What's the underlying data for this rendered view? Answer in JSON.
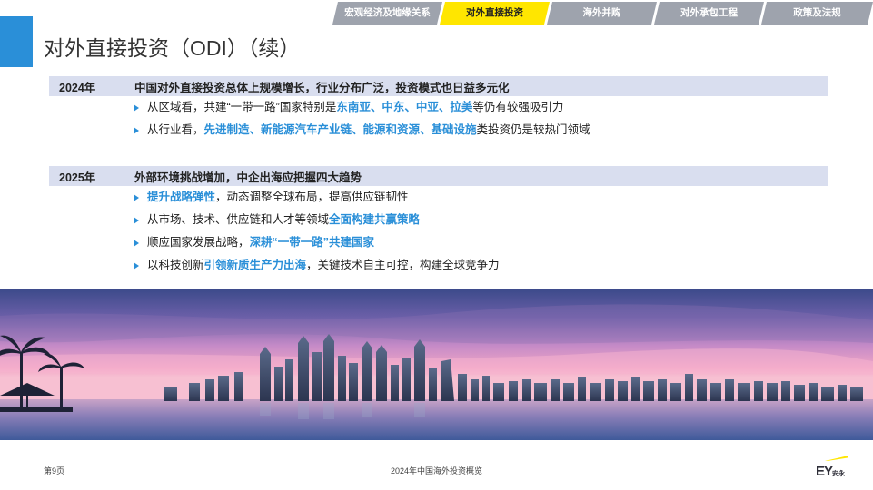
{
  "title": "对外直接投资（ODI）（续）",
  "nav_tabs": [
    {
      "label": "宏观经济及地缘关系",
      "active": false
    },
    {
      "label": "对外直接投资",
      "active": true
    },
    {
      "label": "海外并购",
      "active": false
    },
    {
      "label": "对外承包工程",
      "active": false
    },
    {
      "label": "政策及法规",
      "active": false
    }
  ],
  "sections": [
    {
      "year": "2024年",
      "headline": "中国对外直接投资总体上规模增长，行业分布广泛，投资模式也日益多元化",
      "bullets": [
        {
          "segments": [
            {
              "text": "从区域看，共建“一带一路”国家特别是",
              "hl": false
            },
            {
              "text": "东南亚、中东、中亚、拉美",
              "hl": true
            },
            {
              "text": "等仍有较强吸引力",
              "hl": false
            }
          ]
        },
        {
          "segments": [
            {
              "text": "从行业看，",
              "hl": false
            },
            {
              "text": "先进制造、新能源汽车产业链、能源和资源、基础设施",
              "hl": true
            },
            {
              "text": "类投资仍是较热门领域",
              "hl": false
            }
          ]
        }
      ]
    },
    {
      "year": "2025年",
      "headline": "外部环境挑战增加，中企出海应把握四大趋势",
      "bullets": [
        {
          "segments": [
            {
              "text": "提升战略弹性",
              "hl": true
            },
            {
              "text": "，动态调整全球布局，提高供应链韧性",
              "hl": false
            }
          ]
        },
        {
          "segments": [
            {
              "text": "从市场、技术、供应链和人才等领域",
              "hl": false
            },
            {
              "text": "全面构建共赢策略",
              "hl": true
            }
          ]
        },
        {
          "segments": [
            {
              "text": "顺应国家发展战略，",
              "hl": false
            },
            {
              "text": "深耕“一带一路”共建国家",
              "hl": true
            }
          ]
        },
        {
          "segments": [
            {
              "text": "以科技创新",
              "hl": false
            },
            {
              "text": "引领新质生产力出海",
              "hl": true
            },
            {
              "text": "，关键技术自主可控，构建全球竞争力",
              "hl": false
            }
          ]
        }
      ]
    }
  ],
  "footer": {
    "page": "第9页",
    "center": "2024年中国海外投资概览",
    "logo_text": "EY",
    "logo_sub": "安永"
  },
  "colors": {
    "accent": "#2a8fd8",
    "highlight_text": "#2a8fd8",
    "section_header_bg": "#d9deef",
    "tab_inactive": "#9ea3ad",
    "tab_active": "#ffe600"
  }
}
